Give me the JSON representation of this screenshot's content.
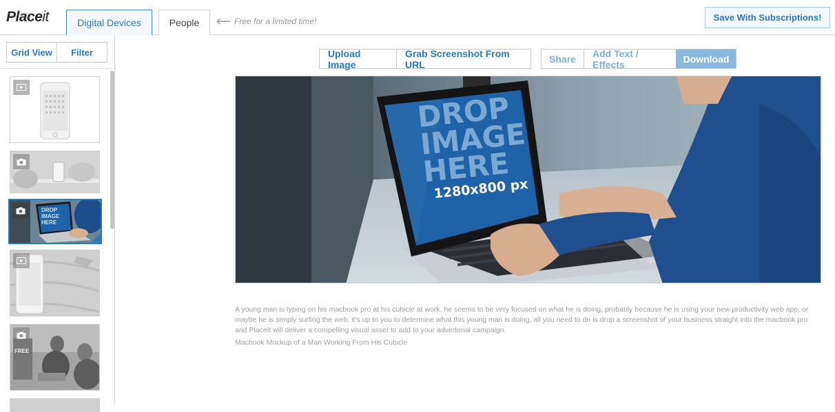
{
  "header": {
    "logo_bold": "Place",
    "logo_light": "it",
    "tabs": [
      {
        "label": "Digital Devices",
        "active": true
      },
      {
        "label": "People",
        "active": false
      }
    ],
    "promo_text": "Free for a limited time!",
    "save_label": "Save With Subscriptions!"
  },
  "sidebar": {
    "view_toggle": [
      "Grid View",
      "Filter"
    ]
  },
  "toolbar": {
    "upload_label": "Upload Image",
    "grab_label": "Grab Screenshot From URL",
    "share_label": "Share",
    "text_label": "Add Text / Effects",
    "download_label": "Download"
  },
  "preview": {
    "screen_line1": "DROP",
    "screen_line2": "IMAGE",
    "screen_line3": "HERE",
    "screen_size": "1280x800 px"
  },
  "content": {
    "description": "A young man is typing on his macbook pro at his cubicle at work, he seems to be very focused on what he is doing, probably because he is using your new productivity web app, or maybe he is simply surfing the web, it's up to you to determine what this young man is doing, all you need to do is drop a screenshot of your business straight into the macbook pro and Placeit will deliver a compelling visual asset to add to your advertorial campaign.",
    "caption": "Macbook Mockup of a Man Working From His Cubicle"
  },
  "thumbnails": [
    {
      "type": "video-icon",
      "thumb_label": ""
    },
    {
      "type": "camera-icon",
      "thumb_label": ""
    },
    {
      "type": "camera-icon",
      "thumb_label": "DROP IMAGE HERE",
      "selected": true
    },
    {
      "type": "video-icon",
      "thumb_label": ""
    },
    {
      "type": "camera-icon",
      "thumb_label": "FREE"
    }
  ],
  "colors": {
    "accent": "#2a7bbd",
    "accent_light": "#8ab8de",
    "screen_blue": "#1e63a8"
  }
}
